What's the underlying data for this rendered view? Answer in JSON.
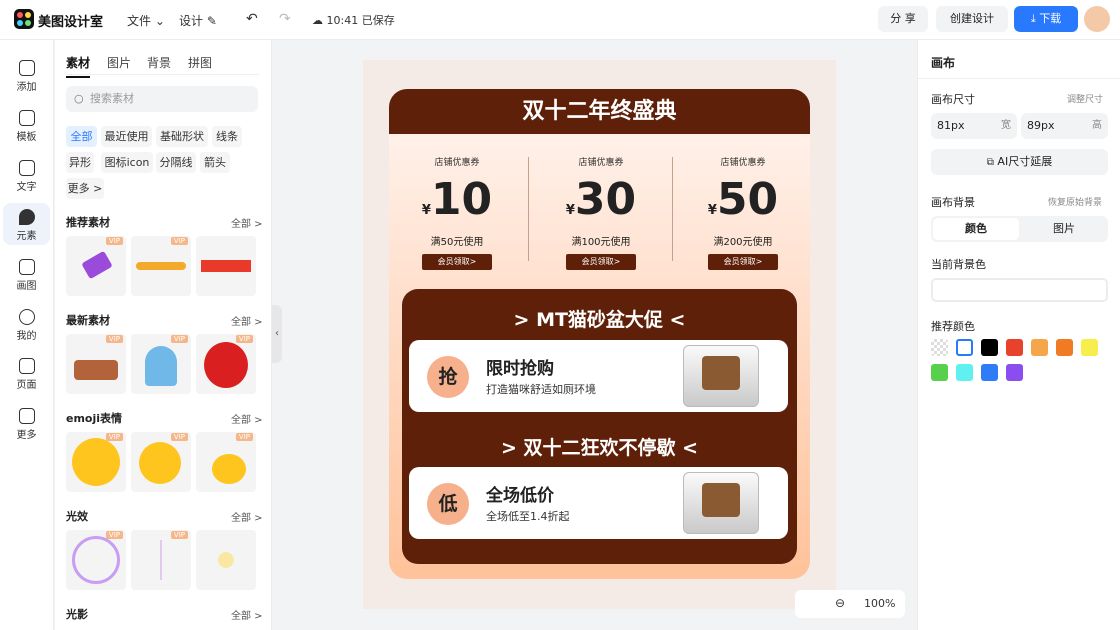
{
  "app": {
    "name": "美图设计室"
  },
  "topbar": {
    "file_menu": "文件",
    "design_menu": "设计",
    "save_status": "10:41 已保存",
    "share_label": "分 享",
    "create_label": "创建设计",
    "download_label": "下载"
  },
  "rail": [
    {
      "label": "添加",
      "icon": "plus-square-icon"
    },
    {
      "label": "模板",
      "icon": "template-icon"
    },
    {
      "label": "文字",
      "icon": "text-icon"
    },
    {
      "label": "元素",
      "icon": "shapes-icon"
    },
    {
      "label": "画图",
      "icon": "pencil-icon"
    },
    {
      "label": "我的",
      "icon": "user-icon"
    },
    {
      "label": "页面",
      "icon": "add-page-icon"
    },
    {
      "label": "更多",
      "icon": "cube-icon"
    }
  ],
  "panel": {
    "tabs": [
      "素材",
      "图片",
      "背景",
      "拼图"
    ],
    "search_placeholder": "搜索素材",
    "chips": [
      "全部",
      "最近使用",
      "基础形状",
      "线条",
      "异形",
      "图标icon",
      "分隔线",
      "箭头",
      "更多 >"
    ],
    "sections": [
      {
        "title": "推荐素材",
        "all": "全部 >"
      },
      {
        "title": "最新素材",
        "all": "全部 >"
      },
      {
        "title": "emoji表情",
        "all": "全部 >"
      },
      {
        "title": "光效",
        "all": "全部 >"
      },
      {
        "title": "光影",
        "all": "全部 >"
      }
    ],
    "vip_label": "VIP"
  },
  "poster": {
    "headline": "双十二年终盛典",
    "coupons": [
      {
        "label": "店铺优惠券",
        "currency": "¥",
        "value": "10",
        "condition": "满50元使用",
        "button": "会员领取>"
      },
      {
        "label": "店铺优惠券",
        "currency": "¥",
        "value": "30",
        "condition": "满100元使用",
        "button": "会员领取>"
      },
      {
        "label": "店铺优惠券",
        "currency": "¥",
        "value": "50",
        "condition": "满200元使用",
        "button": "会员领取>"
      }
    ],
    "section1_title": "> MT猫砂盆大促 <",
    "card1": {
      "badge": "抢",
      "title": "限时抢购",
      "subtitle": "打造猫咪舒适如厕环境"
    },
    "section2_title": "> 双十二狂欢不停歇 <",
    "card2": {
      "badge": "低",
      "title": "全场低价",
      "subtitle": "全场低至1.4折起"
    }
  },
  "zoom": {
    "level": "100%"
  },
  "right": {
    "title": "画布",
    "size_label": "画布尺寸",
    "resize_label": "调整尺寸",
    "width_value": "81px",
    "width_unit": "宽",
    "height_value": "89px",
    "height_unit": "高",
    "ai_extend": "AI尺寸延展",
    "bg_label": "画布背景",
    "restore_bg": "恢复原始背景",
    "bg_tab_color": "颜色",
    "bg_tab_image": "图片",
    "current_bg": "当前背景色",
    "recommended": "推荐颜色",
    "swatches": [
      "transparent",
      "#ffffff",
      "#000000",
      "#e8412c",
      "#f5a64a",
      "#f07b24",
      "#f6ee4a",
      "#57d14c",
      "#5ff0f0",
      "#2e7cf6",
      "#8a4df0"
    ]
  },
  "colors": {
    "accent": "#2979ff",
    "poster_brown": "#5e2008",
    "vip": "#f5b789"
  }
}
